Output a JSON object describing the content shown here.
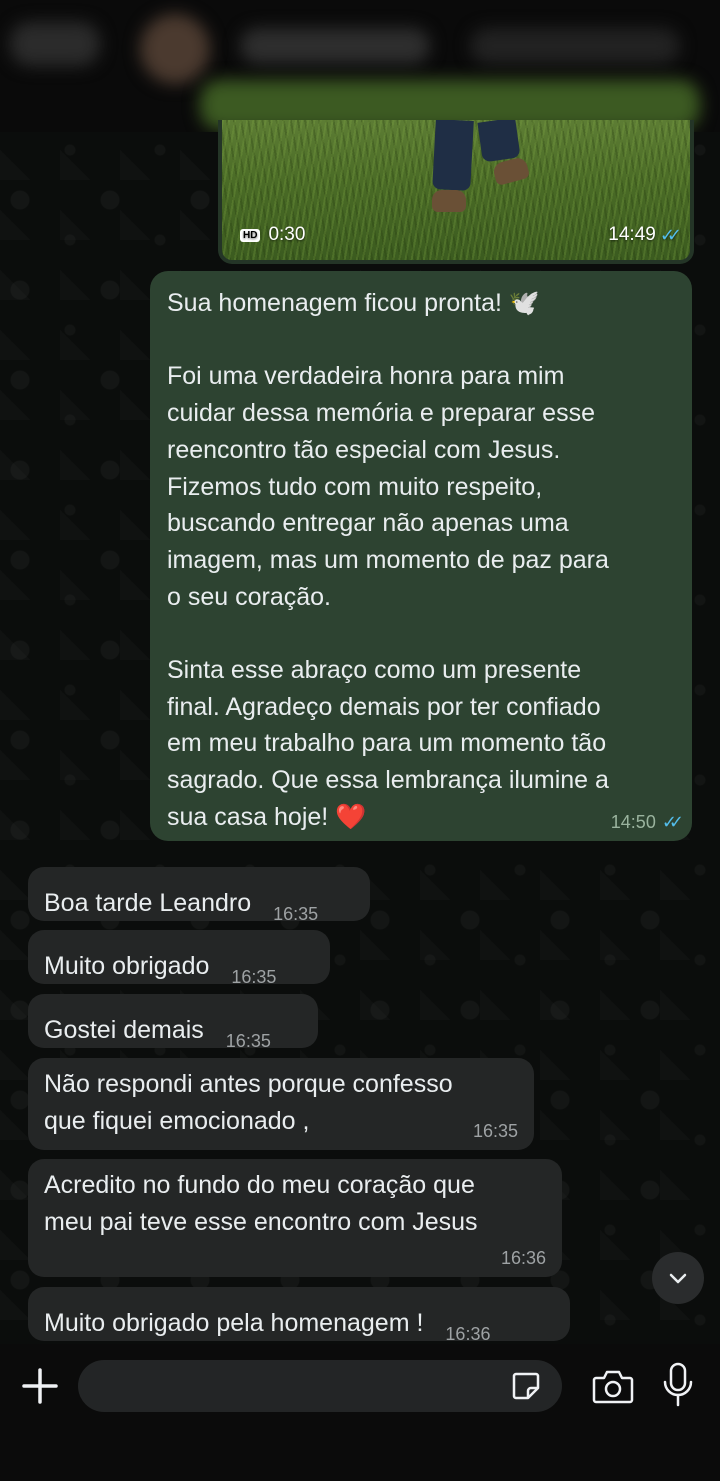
{
  "video": {
    "hd_badge": "HD",
    "duration": "0:30",
    "time": "14:49",
    "ticks": "✓✓"
  },
  "sent_message": {
    "text": "Sua homenagem ficou pronta! 🕊️\n\nFoi uma verdadeira honra para mim\ncuidar dessa memória e preparar esse\nreencontro tão especial com Jesus.\nFizemos tudo com muito respeito,\nbuscando entregar não apenas uma\nimagem, mas um momento de paz para\no seu coração.\n\nSinta esse abraço como um presente\nfinal. Agradeço demais por ter confiado\nem meu trabalho para um momento tão\nsagrado. Que essa lembrança ilumine a\nsua casa hoje! ❤️",
    "time": "14:50",
    "ticks": "✓✓"
  },
  "received_messages": [
    {
      "text": "Boa tarde Leandro",
      "time": "16:35"
    },
    {
      "text": "Muito obrigado",
      "time": "16:35"
    },
    {
      "text": "Gostei demais",
      "time": "16:35"
    },
    {
      "text": "Não respondi antes porque confesso\nque fiquei emocionado ,",
      "time": "16:35"
    },
    {
      "text": "Acredito no fundo do meu coração que\nmeu pai teve esse encontro com Jesus",
      "time": "16:36"
    },
    {
      "text": "Muito obrigado pela homenagem !",
      "time": "16:36"
    }
  ],
  "colors": {
    "sent_bubble": "#2d4331",
    "received_bubble": "#242626",
    "read_ticks": "#53bdeb"
  },
  "icons": {
    "plus": "plus-icon",
    "sticker": "sticker-icon",
    "camera": "camera-icon",
    "mic": "microphone-icon",
    "scroll": "chevron-down-icon"
  }
}
